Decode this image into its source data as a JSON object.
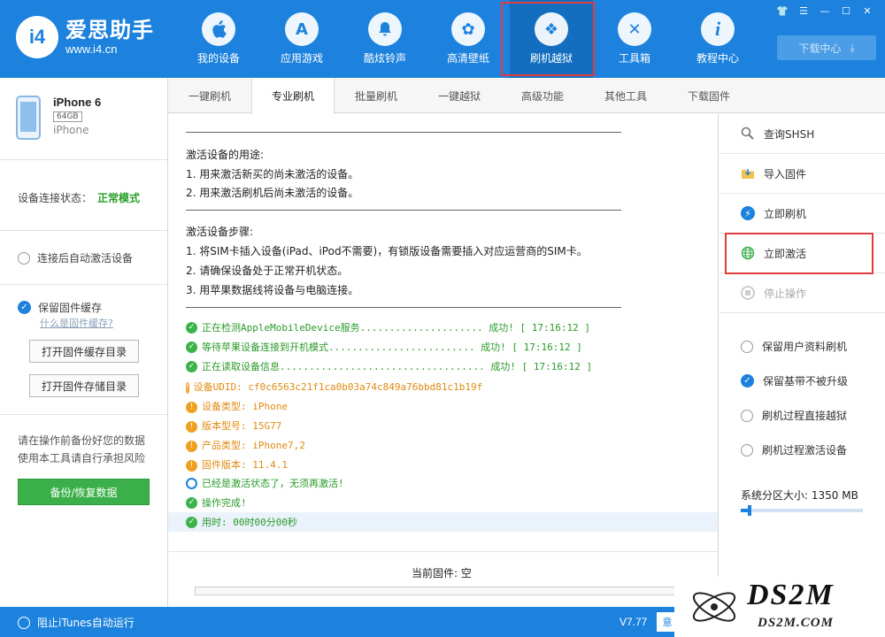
{
  "app": {
    "logo_badge": "i4",
    "logo_name": "爱思助手",
    "logo_url": "www.i4.cn"
  },
  "nav": [
    {
      "label": "我的设备",
      "icon": "apple-icon",
      "glyph": ""
    },
    {
      "label": "应用游戏",
      "icon": "app-store-icon",
      "glyph": "A"
    },
    {
      "label": "酷炫铃声",
      "icon": "bell-icon",
      "glyph": "🔔"
    },
    {
      "label": "高清壁纸",
      "icon": "flower-icon",
      "glyph": "✿"
    },
    {
      "label": "刷机越狱",
      "icon": "dropbox-icon",
      "glyph": "❖"
    },
    {
      "label": "工具箱",
      "icon": "tools-icon",
      "glyph": "✕"
    },
    {
      "label": "教程中心",
      "icon": "info-icon",
      "glyph": "i"
    }
  ],
  "download_center": "下载中心",
  "device": {
    "name": "iPhone 6",
    "capacity": "64GB",
    "model": "iPhone"
  },
  "left": {
    "conn_label": "设备连接状态：",
    "conn_value": "正常模式",
    "auto_activate": "连接后自动激活设备",
    "keep_cache": "保留固件缓存",
    "what_is_cache": "什么是固件缓存?",
    "open_cache_dir": "打开固件缓存目录",
    "open_store_dir": "打开固件存储目录",
    "warning_1": "请在操作前备份好您的数据",
    "warning_2": "使用本工具请自行承担风险",
    "backup_button": "备份/恢复数据"
  },
  "tabs": [
    "一键刷机",
    "专业刷机",
    "批量刷机",
    "一键越狱",
    "高级功能",
    "其他工具",
    "下载固件"
  ],
  "content": {
    "purpose_title": "激活设备的用途:",
    "purpose_1": "1. 用来激活新买的尚未激活的设备。",
    "purpose_2": "2. 用来激活刷机后尚未激活的设备。",
    "steps_title": "激活设备步骤:",
    "step_1": "1. 将SIM卡插入设备(iPad、iPod不需要)，有锁版设备需要插入对应运营商的SIM卡。",
    "step_2": "2. 请确保设备处于正常开机状态。",
    "step_3": "3. 用苹果数据线将设备与电脑连接。",
    "logs": [
      {
        "type": "ok",
        "text": "正在检测AppleMobileDevice服务.....................  成功! [ 17:16:12 ]"
      },
      {
        "type": "ok",
        "text": "等待苹果设备连接到开机模式.........................  成功! [ 17:16:12 ]"
      },
      {
        "type": "ok",
        "text": "正在读取设备信息...................................  成功! [ 17:16:12 ]"
      },
      {
        "type": "warn",
        "text": "设备UDID: cf0c6563c21f1ca0b03a74c849a76bbd81c1b19f"
      },
      {
        "type": "warn",
        "text": "设备类型: iPhone"
      },
      {
        "type": "warn",
        "text": "版本型号: 15G77"
      },
      {
        "type": "warn",
        "text": "产品类型: iPhone7,2"
      },
      {
        "type": "warn",
        "text": "固件版本: 11.4.1"
      },
      {
        "type": "info",
        "text": "已经是激活状态了，无须再激活!"
      },
      {
        "type": "ok",
        "text": "操作完成!"
      },
      {
        "type": "ok",
        "text": "用时: 00时00分00秒"
      }
    ],
    "current_firmware": "当前固件: 空"
  },
  "right": {
    "query_shsh": "查询SHSH",
    "import_firmware": "导入固件",
    "flash_now": "立即刷机",
    "activate_now": "立即激活",
    "stop": "停止操作",
    "keep_user_data": "保留用户资料刷机",
    "keep_baseband": "保留基带不被升级",
    "jailbreak_during": "刷机过程直接越狱",
    "activate_during": "刷机过程激活设备",
    "sys_partition": "系统分区大小:  1350 MB",
    "slider_fraction": 0.06
  },
  "footer": {
    "block_itunes": "阻止iTunes自动运行",
    "version": "V7.77",
    "btn": "意"
  },
  "watermark": {
    "main": "DS2M",
    "sub": "DS2M.COM"
  },
  "colors": {
    "primary": "#1c82dd",
    "success": "#2aa02a",
    "warning": "#f0a020",
    "highlight": "#e03c3c"
  }
}
